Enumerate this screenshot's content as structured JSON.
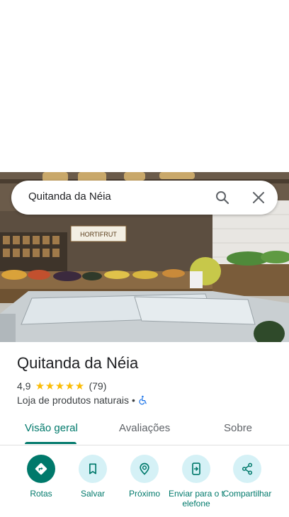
{
  "search": {
    "query": "Quitanda da Néia"
  },
  "photo": {
    "sign_text": "HORTIFRUT"
  },
  "place": {
    "name": "Quitanda da Néia",
    "rating": "4,9",
    "stars": 5,
    "reviews_count": "(79)",
    "category": "Loja de produtos naturais",
    "separator": "•"
  },
  "tabs": [
    {
      "label": "Visão geral",
      "active": true
    },
    {
      "label": "Avaliações",
      "active": false
    },
    {
      "label": "Sobre",
      "active": false
    }
  ],
  "actions": [
    {
      "label": "Rotas",
      "icon": "directions-icon"
    },
    {
      "label": "Salvar",
      "icon": "bookmark-icon"
    },
    {
      "label": "Próximo",
      "icon": "nearby-icon"
    },
    {
      "label": "Enviar para o telefone",
      "icon": "send-to-phone-icon"
    },
    {
      "label": "Compartilhar",
      "icon": "share-icon"
    }
  ],
  "colors": {
    "accent": "#00796b",
    "action_bg": "#d5f1f6",
    "star": "#fbbc04"
  }
}
